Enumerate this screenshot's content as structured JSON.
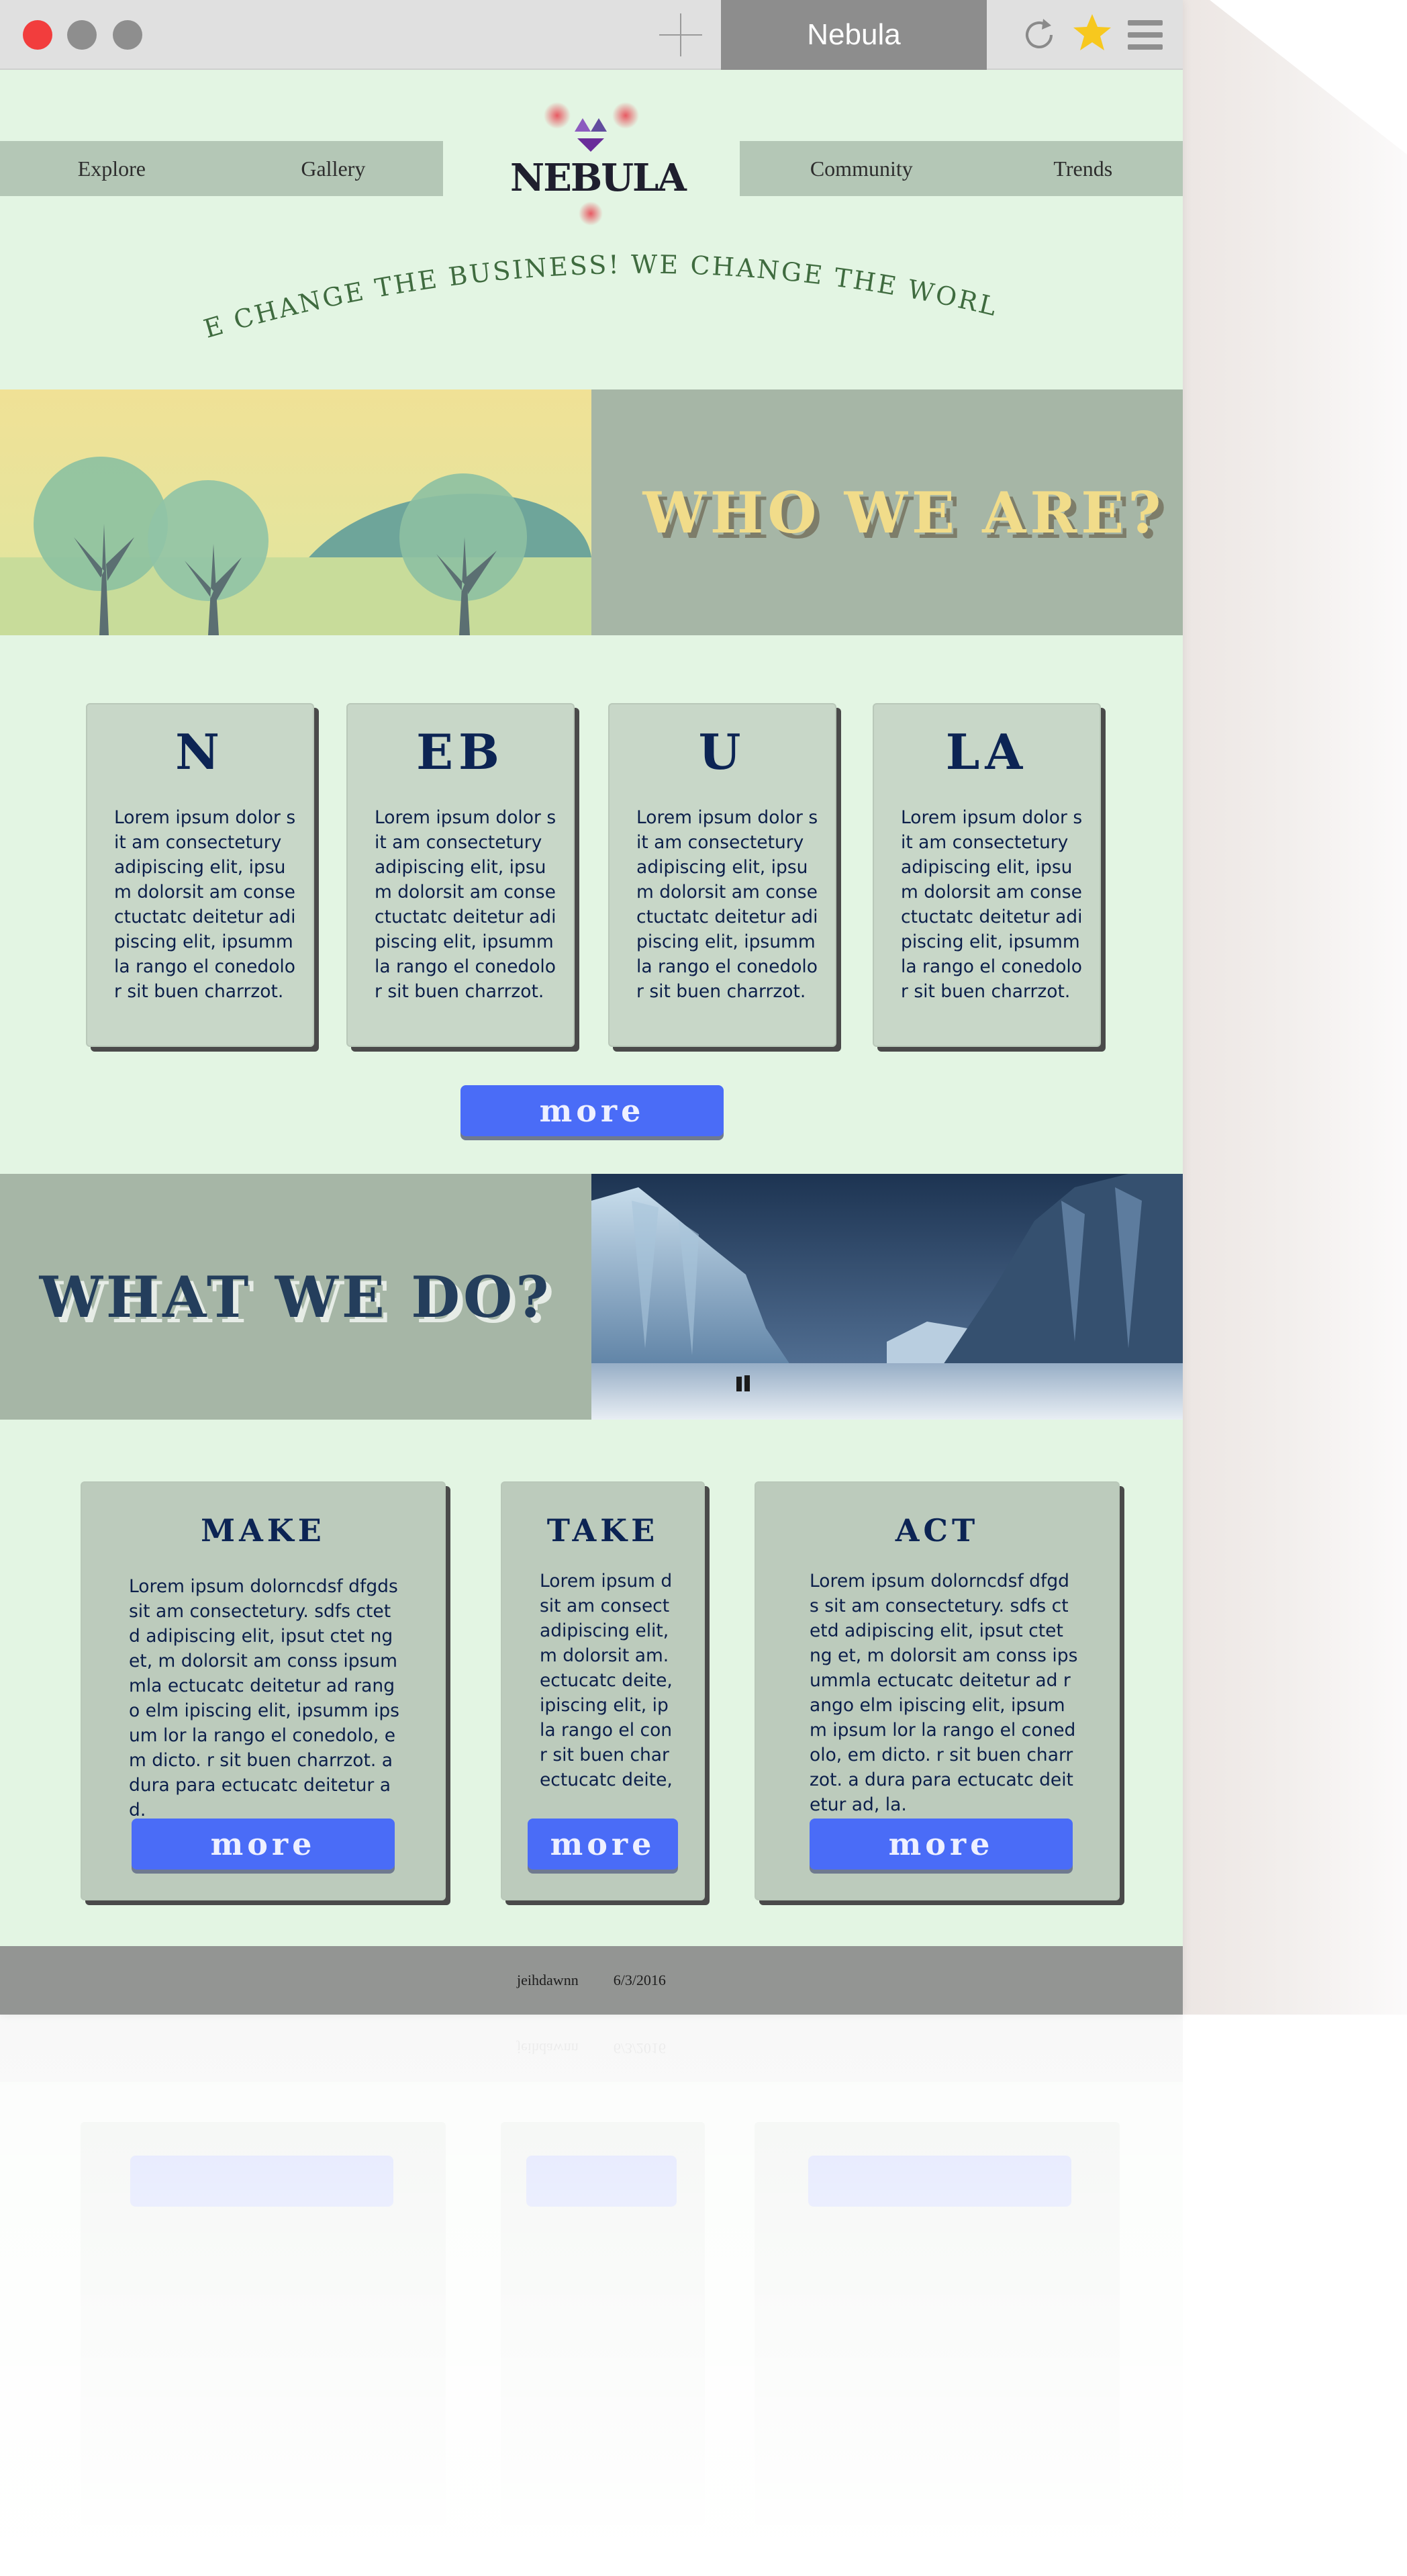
{
  "browser": {
    "tab_title": "Nebula",
    "icons": [
      "close-window-icon",
      "minimize-window-icon",
      "zoom-window-icon",
      "new-tab-icon",
      "reload-icon",
      "bookmark-star-icon",
      "menu-icon"
    ]
  },
  "nav": {
    "left": [
      "Explore",
      "Gallery"
    ],
    "right": [
      "Community",
      "Trends"
    ]
  },
  "logo": {
    "text": "NEBULA"
  },
  "slogan": "“WE CHANGE THE BUSINESS! WE CHANGE THE WORLD!”",
  "who": {
    "heading": "WHO WE ARE?"
  },
  "nebula_cards": [
    {
      "title": "N",
      "text": "Lorem ipsum dolor sit am consectetury adipiscing elit, ipsum dolorsit am consectuctatc deitetur adipiscing elit, ipsummla rango el conedolor sit buen charrzot."
    },
    {
      "title": "EB",
      "text": "Lorem ipsum dolor sit am consectetury adipiscing elit, ipsum dolorsit am consectuctatc deitetur adipiscing elit, ipsummla rango el conedolor sit buen charrzot."
    },
    {
      "title": "U",
      "text": "Lorem ipsum dolor sit am consectetury adipiscing elit, ipsum dolorsit am consectuctatc deitetur adipiscing elit, ipsummla rango el conedolor sit buen charrzot."
    },
    {
      "title": "LA",
      "text": "Lorem ipsum dolor sit am consectetury adipiscing elit, ipsum dolorsit am consectuctatc deitetur adipiscing elit, ipsummla rango el conedolor sit buen charrzot."
    }
  ],
  "more_label": "more",
  "what": {
    "heading": "WHAT WE DO?"
  },
  "do_cards": [
    {
      "title": "MAKE",
      "text": "Lorem ipsum dolorncdsf dfgds sit am consectetury. sdfs ctetd adipiscing elit, ipsut ctet ng et, m dolorsit am conss ipsummla ectucatc deitetur ad rango elm ipiscing elit, ipsumm ipsum lor la rango el conedolo, em dicto. r sit buen charrzot. a dura para ectucatc deitetur ad."
    },
    {
      "title": "TAKE",
      "text": "Lorem ipsum d sit am consect adipiscing elit, m dolorsit am. ectucatc deite, ipiscing elit, ip la rango el con r sit buen char ectucatc deite,"
    },
    {
      "title": "ACT",
      "text": "Lorem ipsum dolorncdsf dfgds sit am consectetury. sdfs ctetd adipiscing elit, ipsut ctet ng et, m dolorsit am conss ipsummla ectucatc deitetur ad rango elm ipiscing elit, ipsumm ipsum lor la rango el conedolo, em dicto. r sit buen charrzot. a dura para ectucatc deitetur ad, la."
    }
  ],
  "footer": {
    "author": "jeihdawnn",
    "date": "6/3/2016"
  },
  "colors": {
    "page_bg": "#e3f5e3",
    "nav_bg": "#b4c7b6",
    "panel_gray": "#a6b6a6",
    "card_bg": "#c8d7c8",
    "heading_navy": "#0c2454",
    "button_blue": "#4a6cf7",
    "who_yellow": "#f1dc8a",
    "footer_gray": "#939593",
    "close_red": "#f23d3d",
    "star_yellow": "#f7c81e"
  }
}
